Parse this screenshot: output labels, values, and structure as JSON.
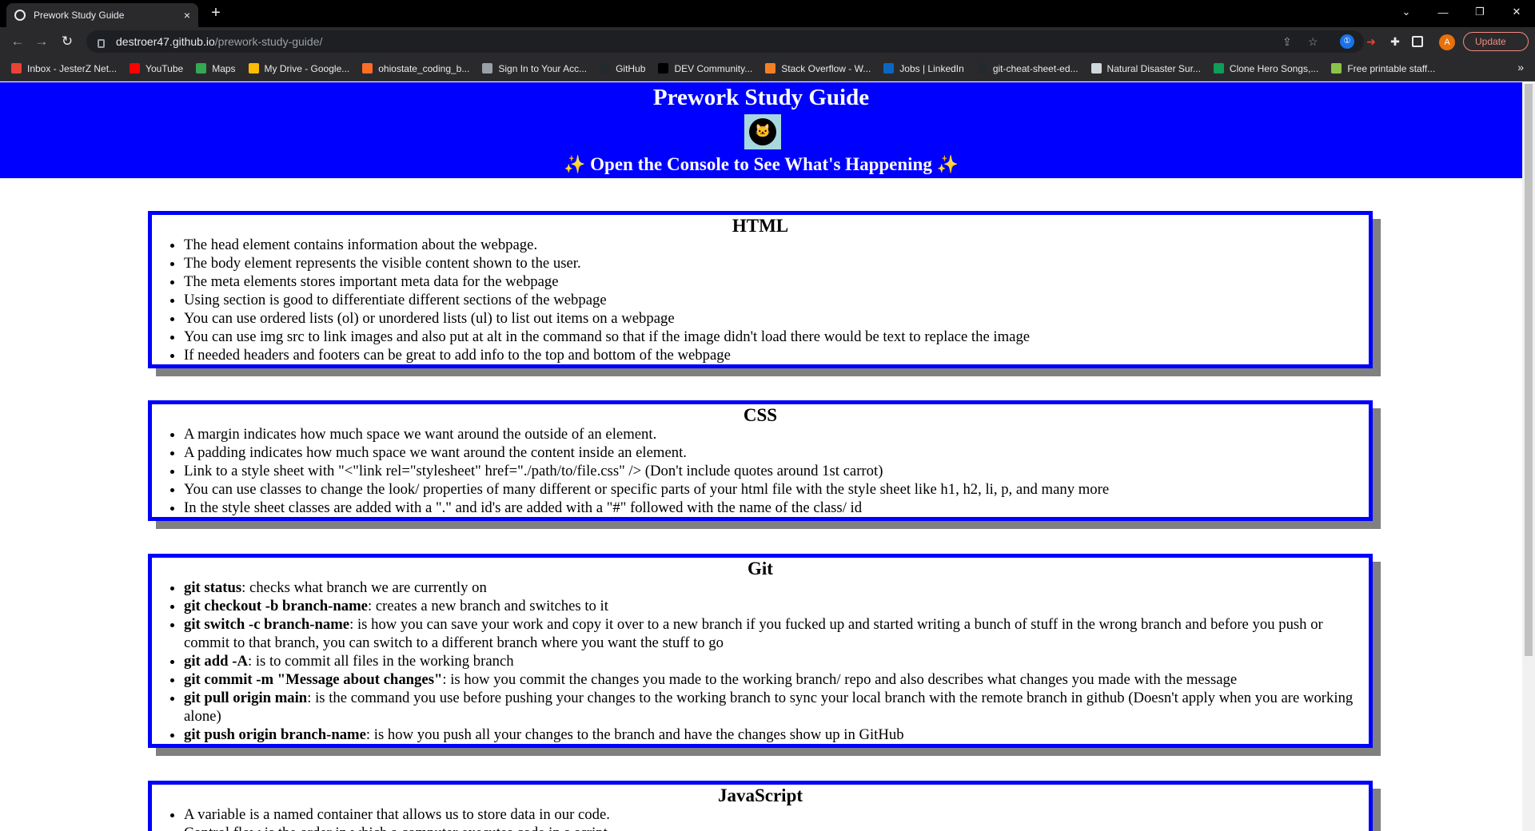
{
  "browser": {
    "tab_title": "Prework Study Guide",
    "tab_close": "×",
    "new_tab": "+",
    "url_host": "destroer47.github.io",
    "url_path": "/prework-study-guide/",
    "update_label": "Update",
    "avatar_letter": "A",
    "bookmarks": [
      {
        "label": "Inbox - JesterZ Net...",
        "color": "#ea4335"
      },
      {
        "label": "YouTube",
        "color": "#ff0000"
      },
      {
        "label": "Maps",
        "color": "#34a853"
      },
      {
        "label": "My Drive - Google...",
        "color": "#fbbc04"
      },
      {
        "label": "ohiostate_coding_b...",
        "color": "#fc6d26"
      },
      {
        "label": "Sign In to Your Acc...",
        "color": "#9aa0a6"
      },
      {
        "label": "GitHub",
        "color": "#24292e"
      },
      {
        "label": "DEV Community...",
        "color": "#000000"
      },
      {
        "label": "Stack Overflow - W...",
        "color": "#f48024"
      },
      {
        "label": "Jobs | LinkedIn",
        "color": "#0a66c2"
      },
      {
        "label": "git-cheat-sheet-ed...",
        "color": "#24292e"
      },
      {
        "label": "Natural Disaster Sur...",
        "color": "#cfd8dc"
      },
      {
        "label": "Clone Hero Songs,...",
        "color": "#0f9d58"
      },
      {
        "label": "Free printable staff...",
        "color": "#8bc34a"
      }
    ],
    "bookmarks_more": "»"
  },
  "page": {
    "title": "Prework Study Guide",
    "subtitle": "Open the Console to See What's Happening",
    "sparkle": "✨",
    "logo_glyph": "🐱"
  },
  "sections": [
    {
      "heading": "HTML",
      "items": [
        {
          "strong": "",
          "text": "The head element contains information about the webpage."
        },
        {
          "strong": "",
          "text": "The body element represents the visible content shown to the user."
        },
        {
          "strong": "",
          "text": "The meta elements stores important meta data for the webpage"
        },
        {
          "strong": "",
          "text": "Using section is good to differentiate different sections of the webpage"
        },
        {
          "strong": "",
          "text": "You can use ordered lists (ol) or unordered lists (ul) to list out items on a webpage"
        },
        {
          "strong": "",
          "text": "You can use img src to link images and also put at alt in the command so that if the image didn't load there would be text to replace the image"
        },
        {
          "strong": "",
          "text": "If needed headers and footers can be great to add info to the top and bottom of the webpage"
        }
      ]
    },
    {
      "heading": "CSS",
      "items": [
        {
          "strong": "",
          "text": "A margin indicates how much space we want around the outside of an element."
        },
        {
          "strong": "",
          "text": "A padding indicates how much space we want around the content inside an element."
        },
        {
          "strong": "",
          "text": "Link to a style sheet with \"<\"link rel=\"stylesheet\" href=\"./path/to/file.css\" /> (Don't include quotes around 1st carrot)"
        },
        {
          "strong": "",
          "text": "You can use classes to change the look/ properties of many different or specific parts of your html file with the style sheet like h1, h2, li, p, and many more"
        },
        {
          "strong": "",
          "text": "In the style sheet classes are added with a \".\" and id's are added with a \"#\" followed with the name of the class/ id"
        }
      ]
    },
    {
      "heading": "Git",
      "items": [
        {
          "strong": "git status",
          "text": ": checks what branch we are currently on"
        },
        {
          "strong": "git checkout -b branch-name",
          "text": ": creates a new branch and switches to it"
        },
        {
          "strong": "git switch -c branch-name",
          "text": ": is how you can save your work and copy it over to a new branch if you fucked up and started writing a bunch of stuff in the wrong branch and before you push or commit to that branch, you can switch to a different branch where you want the stuff to go"
        },
        {
          "strong": "git add -A",
          "text": ": is to commit all files in the working branch"
        },
        {
          "strong": "git commit -m \"Message about changes\"",
          "text": ": is how you commit the changes you made to the working branch/ repo and also describes what changes you made with the message"
        },
        {
          "strong": "git pull origin main",
          "text": ": is the command you use before pushing your changes to the working branch to sync your local branch with the remote branch in github (Doesn't apply when you are working alone)"
        },
        {
          "strong": "git push origin branch-name",
          "text": ": is how you push all your changes to the branch and have the changes show up in GitHub"
        }
      ]
    },
    {
      "heading": "JavaScript",
      "items": [
        {
          "strong": "",
          "text": "A variable is a named container that allows us to store data in our code."
        },
        {
          "strong": "",
          "text": "Control flow is the order in which a computer executes code in a script."
        }
      ]
    }
  ]
}
